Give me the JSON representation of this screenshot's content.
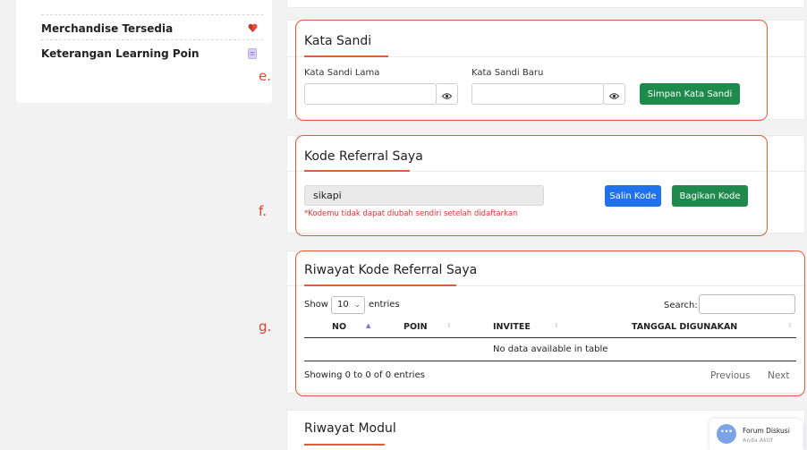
{
  "sidebar": {
    "items": [
      {
        "label": "Merchandise Tersedia",
        "icon": "heart-gem-icon"
      },
      {
        "label": "Keterangan Learning Poin",
        "icon": "document-icon"
      }
    ]
  },
  "markers": {
    "e": "e.",
    "f": "f.",
    "g": "g."
  },
  "password_card": {
    "title": "Kata Sandi",
    "old_label": "Kata Sandi Lama",
    "new_label": "Kata Sandi Baru",
    "old_value": "",
    "new_value": "",
    "save_button": "Simpan Kata Sandi"
  },
  "referral_card": {
    "title": "Kode Referral Saya",
    "code": "sikapi",
    "warning": "*Kodemu tidak dapat diubah sendiri setelah didaftarkan",
    "copy_button": "Salin Kode",
    "share_button": "Bagikan Kode"
  },
  "history_card": {
    "title": "Riwayat Kode Referral Saya",
    "show_label": "Show",
    "entries_value": "10",
    "entries_label": "entries",
    "search_label": "Search:",
    "search_value": "",
    "columns": [
      "NO",
      "POIN",
      "INVITEE",
      "TANGGAL DIGUNAKAN"
    ],
    "empty_text": "No data available in table",
    "info_text": "Showing 0 to 0 of 0 entries",
    "previous": "Previous",
    "next": "Next"
  },
  "module_card": {
    "title": "Riwayat Modul"
  },
  "chat_widget": {
    "title": "Forum Diskusi",
    "subtitle": "Anda Aktif",
    "icon": "chat-bubble-icon"
  },
  "colors": {
    "accent": "#e55a39",
    "green": "#1e8a4c",
    "blue": "#1f72ec",
    "warning": "#e0332f"
  }
}
